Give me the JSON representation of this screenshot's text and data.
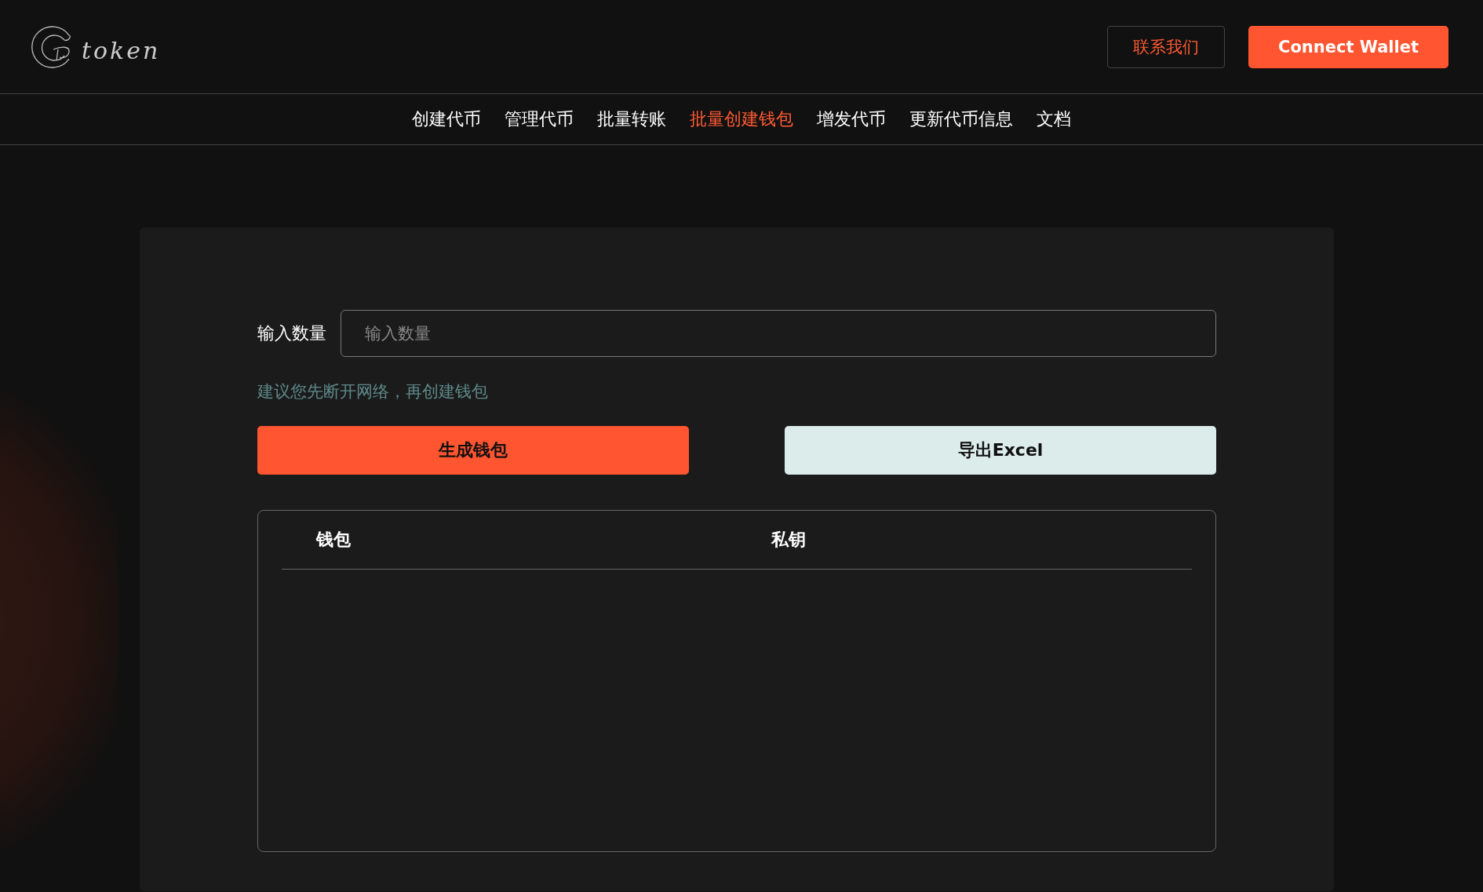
{
  "header": {
    "logo_text": "token",
    "contact_button": "联系我们",
    "connect_button": "Connect Wallet"
  },
  "nav": [
    {
      "label": "创建代币",
      "selected": false
    },
    {
      "label": "管理代币",
      "selected": false
    },
    {
      "label": "批量转账",
      "selected": false
    },
    {
      "label": "批量创建钱包",
      "selected": true
    },
    {
      "label": "增发代币",
      "selected": false
    },
    {
      "label": "更新代币信息",
      "selected": false
    },
    {
      "label": "文档",
      "selected": false
    }
  ],
  "form": {
    "label": "输入数量",
    "placeholder": "输入数量",
    "hint": "建议您先断开网络，再创建钱包"
  },
  "buttons": [
    {
      "label": "生成钱包",
      "kind": "primary"
    },
    {
      "label": "导出Excel",
      "kind": "secondary"
    }
  ],
  "table": {
    "columns": [
      "钱包",
      "私钥"
    ]
  }
}
